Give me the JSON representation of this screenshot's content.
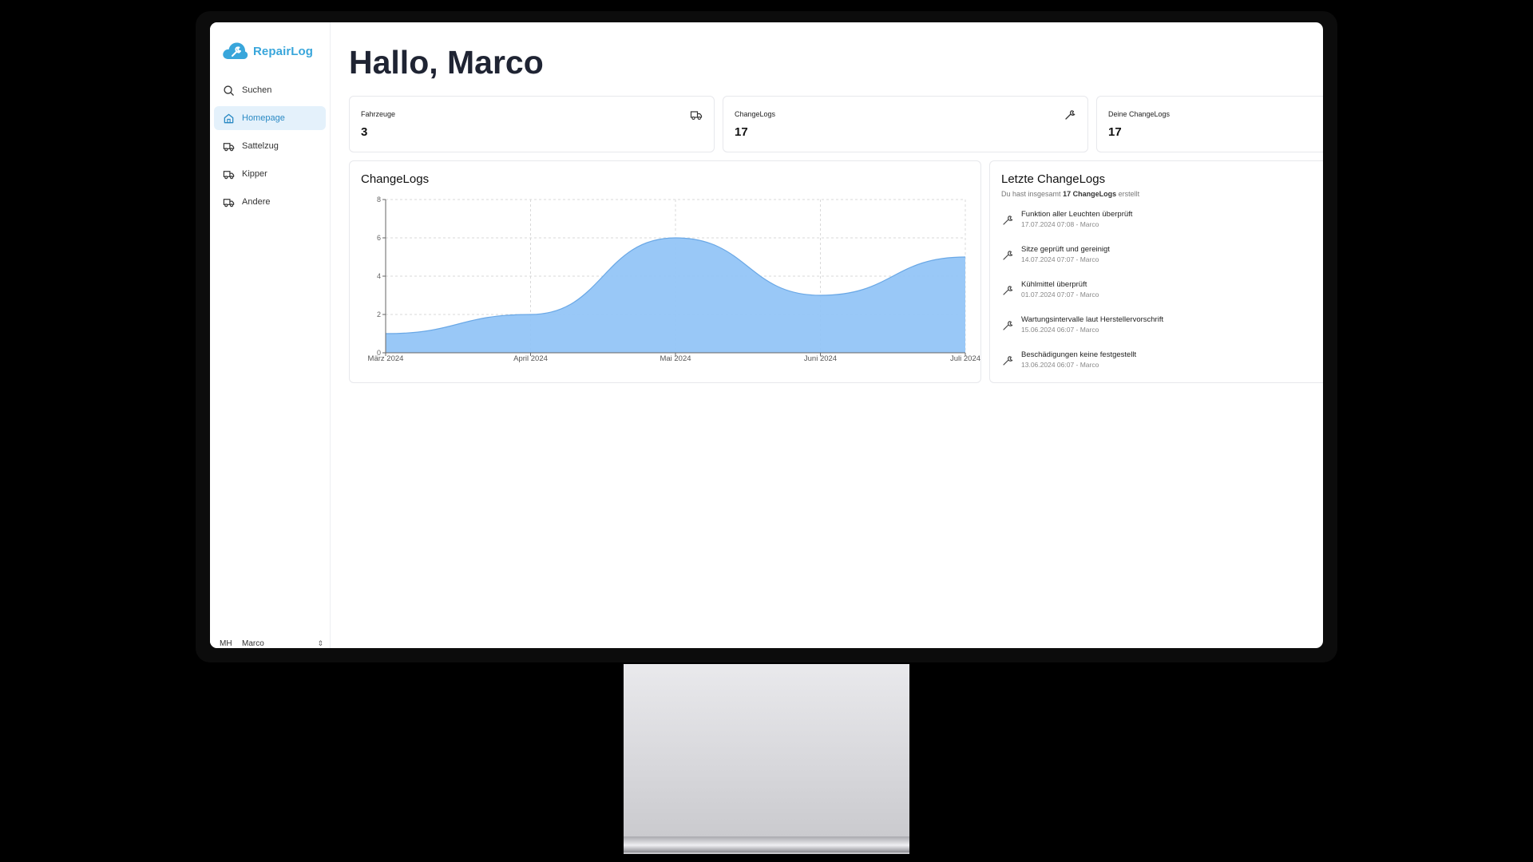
{
  "app": {
    "name": "RepairLog"
  },
  "colors": {
    "accent": "#39a6db",
    "active_bg": "#e4f1fb",
    "chart_fill": "#93c5f7",
    "chart_stroke": "#6aa8e6"
  },
  "sidebar": {
    "items": [
      {
        "label": "Suchen",
        "icon": "search-icon"
      },
      {
        "label": "Homepage",
        "icon": "home-icon",
        "active": true
      },
      {
        "label": "Sattelzug",
        "icon": "truck-icon"
      },
      {
        "label": "Kipper",
        "icon": "truck-icon"
      },
      {
        "label": "Andere",
        "icon": "truck-icon"
      }
    ],
    "user": {
      "initials": "MH",
      "name": "Marco"
    }
  },
  "main": {
    "greeting": "Hallo, Marco",
    "stats": [
      {
        "label": "Fahrzeuge",
        "value": "3",
        "icon": "truck-icon"
      },
      {
        "label": "ChangeLogs",
        "value": "17",
        "icon": "wrench-icon"
      },
      {
        "label": "Deine ChangeLogs",
        "value": "17"
      }
    ],
    "chart_panel": {
      "title": "ChangeLogs"
    },
    "recent": {
      "title": "Letzte ChangeLogs",
      "subtitle_prefix": "Du hast insgesamt",
      "subtitle_count": "17 ChangeLogs",
      "subtitle_suffix": "erstellt",
      "items": [
        {
          "title": "Funktion aller Leuchten überprüft",
          "meta": "17.07.2024 07:08 - Marco"
        },
        {
          "title": "Sitze geprüft und gereinigt",
          "meta": "14.07.2024 07:07 - Marco"
        },
        {
          "title": "Kühlmittel überprüft",
          "meta": "01.07.2024 07:07 - Marco"
        },
        {
          "title": "Wartungsintervalle laut Herstellervorschrift",
          "meta": "15.06.2024 06:07 - Marco"
        },
        {
          "title": "Beschädigungen keine festgestellt",
          "meta": "13.06.2024 06:07 - Marco"
        }
      ]
    }
  },
  "chart_data": {
    "type": "area",
    "categories": [
      "März 2024",
      "April 2024",
      "Mai 2024",
      "Juni 2024",
      "Juli 2024"
    ],
    "values": [
      1,
      2,
      6,
      3,
      5
    ],
    "title": "ChangeLogs",
    "xlabel": "",
    "ylabel": "",
    "ylim": [
      0,
      8
    ],
    "yticks": [
      0,
      2,
      4,
      6,
      8
    ],
    "grid": true
  }
}
